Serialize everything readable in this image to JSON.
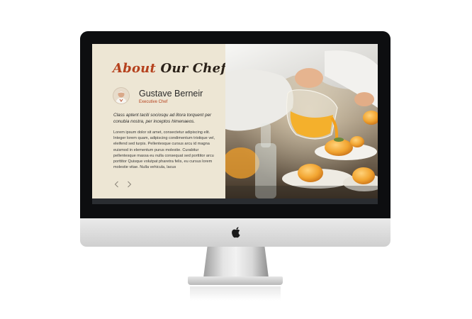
{
  "section": {
    "title_accent": "About",
    "title_rest": "Our Chefs"
  },
  "chef": {
    "name": "Gustave Berneir",
    "role": "Executive Chef",
    "quote": "Class aptent taciti sociosqu ad litora torquent per conubia nostra, per inceptos himenaeos.",
    "bio": "Lorem ipsum dolor sit amet, consectetur adipiscing elit. Integer lorem quam, adipiscing condimentum tristique vel, eleifend sed turpis. Pellentesque cursus arcu id magna euismod in elementum purus molestie. Curabitur pellentesque massa eu nulla consequat sed porttitor arcu porttitor Quisque volutpat pharetra felis, eu cursus lorem molestie vitae. Nulla vehicula, lacus"
  },
  "navigation": {
    "prev_icon": "chevron-left-icon",
    "next_icon": "chevron-right-icon"
  },
  "device": {
    "logo_icon": "apple-logo-icon"
  },
  "colors": {
    "accent": "#b5411d",
    "panel_background": "#ede6d4",
    "text": "#2b2b2b"
  }
}
